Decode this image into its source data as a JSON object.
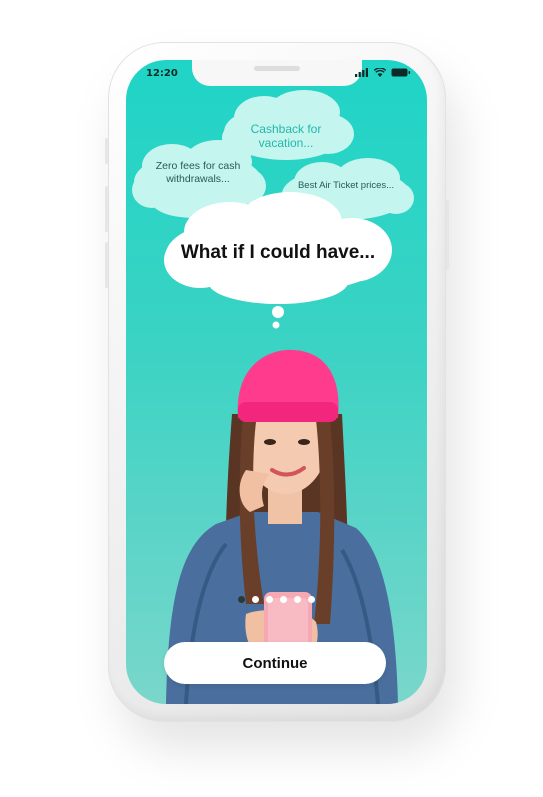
{
  "status_bar": {
    "time": "12:20"
  },
  "thoughts": {
    "cashback": "Cashback for vacation...",
    "zero_fees": "Zero fees for cash withdrawals...",
    "air_ticket": "Best Air Ticket prices...",
    "main": "What if I could have..."
  },
  "pager": {
    "count": 6,
    "active_index": 0
  },
  "actions": {
    "continue_label": "Continue"
  },
  "colors": {
    "accent": "#1fd4c6",
    "hat": "#ff3b8e",
    "jacket": "#4a6f9e"
  },
  "icons": [
    "signal-icon",
    "wifi-icon",
    "battery-icon"
  ]
}
